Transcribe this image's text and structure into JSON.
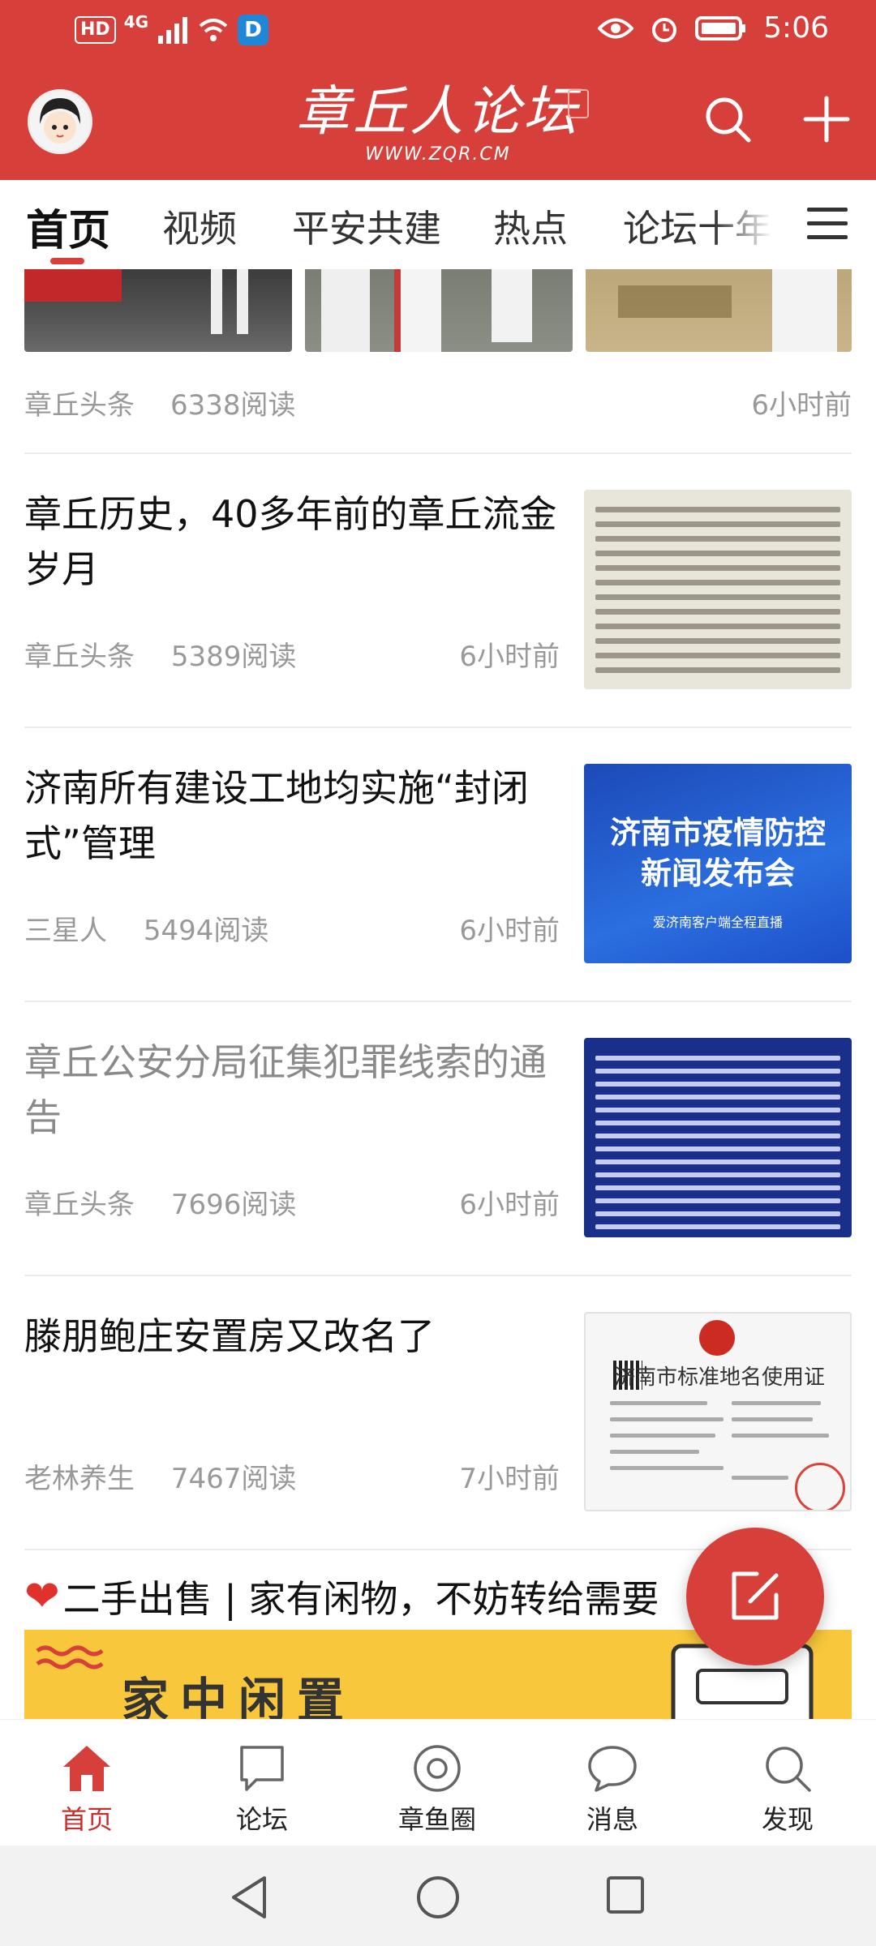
{
  "status_bar": {
    "hd": "HD",
    "network": "4G",
    "app_badge": "D",
    "time": "5:06"
  },
  "header": {
    "logo_text": "章丘人论坛",
    "logo_url": "WWW.ZQR.CM",
    "avatar_icon": "avatar-cartoon",
    "accent_color": "#d7403a"
  },
  "tabs": [
    {
      "label": "首页",
      "active": true
    },
    {
      "label": "视频"
    },
    {
      "label": "平安共建"
    },
    {
      "label": "热点"
    },
    {
      "label": "论坛十年"
    }
  ],
  "top_item": {
    "source": "章丘头条",
    "reads": "6338阅读",
    "time": "6小时前"
  },
  "articles": [
    {
      "title": "章丘历史，40多年前的章丘流金岁月",
      "source": "章丘头条",
      "reads": "5389阅读",
      "time": "6小时前",
      "read": false
    },
    {
      "title": "济南所有建设工地均实施“封闭式”管理",
      "source": "三星人",
      "reads": "5494阅读",
      "time": "6小时前",
      "read": false,
      "thumb_line1": "济南市疫情防控",
      "thumb_line2": "新闻发布会",
      "thumb_caption": "爱济南客户端全程直播"
    },
    {
      "title": "章丘公安分局征集犯罪线索的通告",
      "source": "章丘头条",
      "reads": "7696阅读",
      "time": "6小时前",
      "read": true
    },
    {
      "title": "滕朋鲍庄安置房又改名了",
      "source": "老林养生",
      "reads": "7467阅读",
      "time": "7小时前",
      "read": false,
      "thumb_line1": "济南市标准地名使用证"
    }
  ],
  "promo": {
    "title": "二手出售 | 家有闲物，不妨转给需要",
    "banner_text": "家中闲置"
  },
  "bottom_nav": [
    {
      "label": "首页",
      "icon": "home-icon",
      "active": true
    },
    {
      "label": "论坛",
      "icon": "chat-square-icon"
    },
    {
      "label": "章鱼圈",
      "icon": "circle-lens-icon"
    },
    {
      "label": "消息",
      "icon": "message-bubble-icon"
    },
    {
      "label": "发现",
      "icon": "search-icon"
    }
  ]
}
